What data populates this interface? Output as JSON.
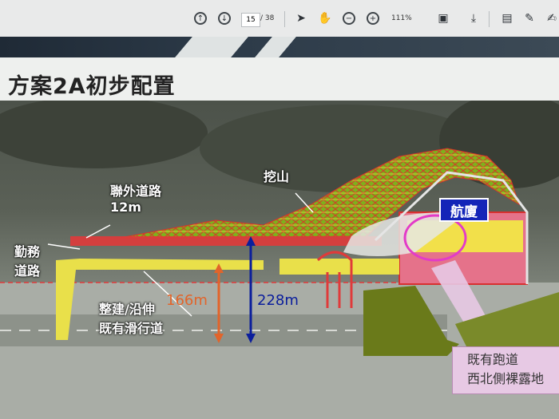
{
  "toolbar": {
    "page_current": "15",
    "page_total": "/ 38",
    "zoom": "111%",
    "icons": [
      "up-icon",
      "down-icon",
      "pointer-icon",
      "hand-icon",
      "zoom-out-icon",
      "zoom-in-icon",
      "fit-icon",
      "download-icon",
      "comment-icon",
      "pen-icon",
      "sign-icon"
    ]
  },
  "slide": {
    "title": "方案2A初步配置"
  },
  "map": {
    "label_road": "聯外道路",
    "label_road_width": "12m",
    "label_service_1": "勤務",
    "label_service_2": "道路",
    "label_dig": "挖山",
    "label_terminal": "航廈",
    "label_taxiway_1": "整建/沿伸",
    "label_taxiway_2": "既有滑行道",
    "dim_166": "166m",
    "dim_228": "228m",
    "callout_1": "既有跑道",
    "callout_2": "西北側裸露地"
  },
  "colors": {
    "terrain_green": "#8fbf2a",
    "terrain_red": "#d83030",
    "taxiway_yellow": "#e9e04a",
    "arrow_orange": "#e2642a",
    "arrow_blue": "#0b1e9c",
    "terminal_blue": "#1325b8",
    "callout_pink": "#e7c9e4"
  }
}
